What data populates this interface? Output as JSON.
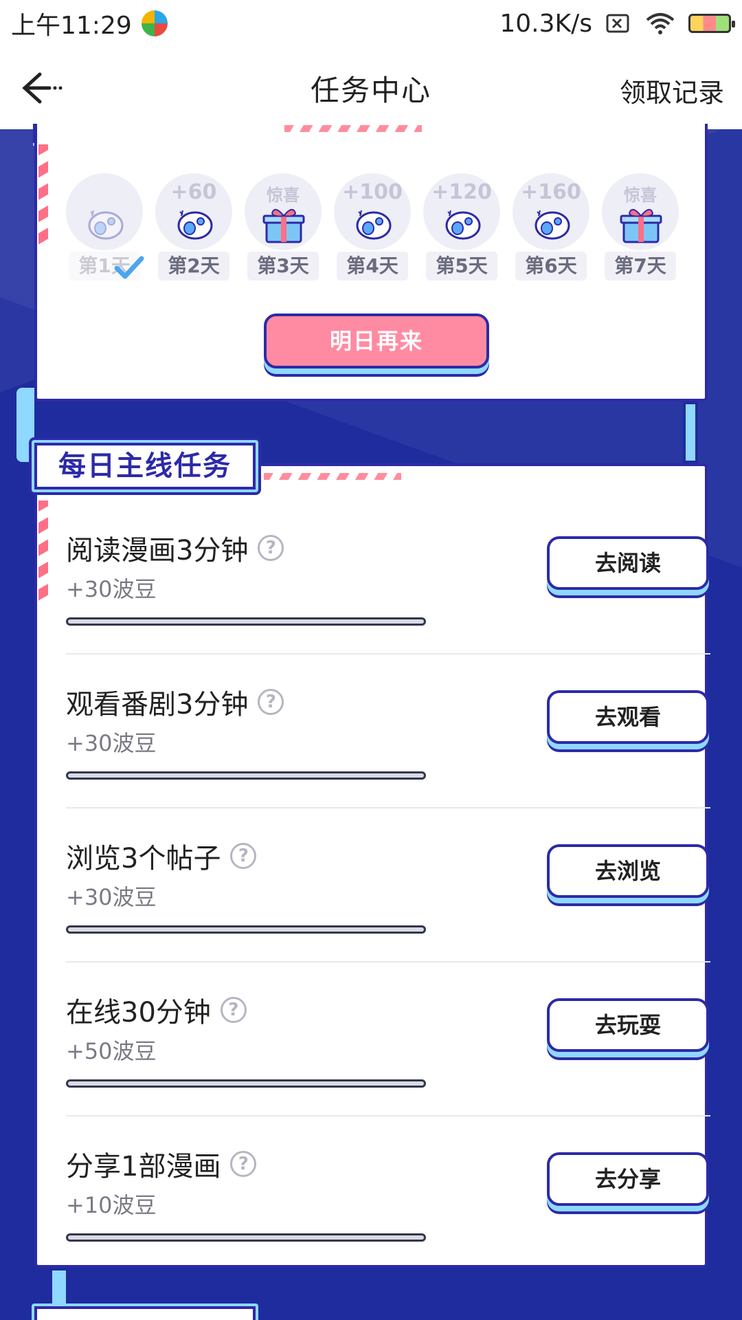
{
  "status_bar": {
    "time": "上午11:29",
    "network_speed": "10.3K/s"
  },
  "nav": {
    "title": "任务中心",
    "right_action": "领取记录"
  },
  "checkin": {
    "days": [
      {
        "label": "第1天",
        "reward": "",
        "icon": "egg-icon",
        "completed": true
      },
      {
        "label": "第2天",
        "reward": "+60",
        "icon": "egg-icon",
        "completed": false
      },
      {
        "label": "第3天",
        "reward": "惊喜",
        "icon": "gift-icon",
        "completed": false
      },
      {
        "label": "第4天",
        "reward": "+100",
        "icon": "egg-icon",
        "completed": false
      },
      {
        "label": "第5天",
        "reward": "+120",
        "icon": "egg-icon",
        "completed": false
      },
      {
        "label": "第6天",
        "reward": "+160",
        "icon": "egg-icon",
        "completed": false
      },
      {
        "label": "第7天",
        "reward": "惊喜",
        "icon": "gift-icon",
        "completed": false
      }
    ],
    "button_label": "明日再来"
  },
  "daily_tasks": {
    "title": "每日主线任务",
    "items": [
      {
        "title": "阅读漫画3分钟",
        "reward": "+30波豆",
        "button": "去阅读",
        "progress": 0
      },
      {
        "title": "观看番剧3分钟",
        "reward": "+30波豆",
        "button": "去观看",
        "progress": 0
      },
      {
        "title": "浏览3个帖子",
        "reward": "+30波豆",
        "button": "去浏览",
        "progress": 0
      },
      {
        "title": "在线30分钟",
        "reward": "+50波豆",
        "button": "去玩耍",
        "progress": 0
      },
      {
        "title": "分享1部漫画",
        "reward": "+10波豆",
        "button": "去分享",
        "progress": 0
      }
    ]
  },
  "colors": {
    "background": "#1e2c9e",
    "card_border": "#2d2aa8",
    "accent_light": "#8fd8ff",
    "pink_button": "#ff8ba3"
  }
}
